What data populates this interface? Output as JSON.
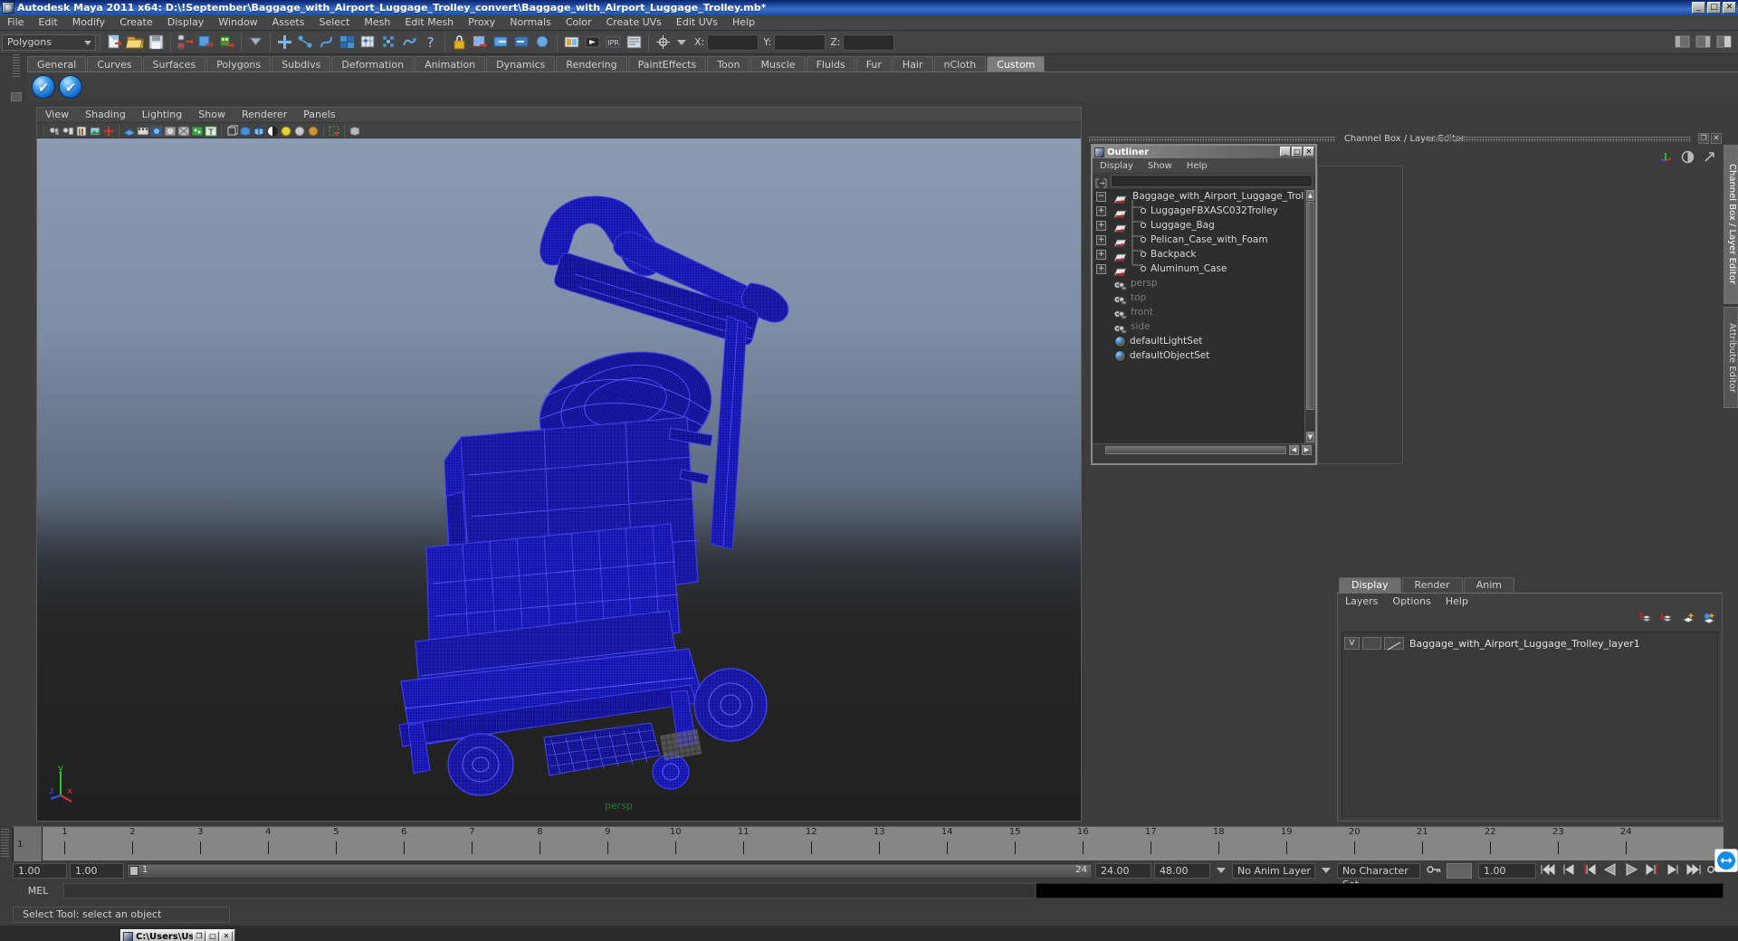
{
  "window": {
    "title": "Autodesk Maya 2011 x64: D:\\!September\\Baggage_with_Airport_Luggage_Trolley_convert\\Baggage_with_Airport_Luggage_Trolley.mb*",
    "minimize": "_",
    "maximize": "□",
    "close": "✕"
  },
  "menubar": {
    "items": [
      "File",
      "Edit",
      "Modify",
      "Create",
      "Display",
      "Window",
      "Assets",
      "Select",
      "Mesh",
      "Edit Mesh",
      "Proxy",
      "Normals",
      "Color",
      "Create UVs",
      "Edit UVs",
      "Help"
    ]
  },
  "statusline": {
    "selection_mode": "Polygons",
    "coord_labels": {
      "x": "X:",
      "y": "Y:",
      "z": "Z:"
    },
    "coord_values": {
      "x": "",
      "y": "",
      "z": ""
    }
  },
  "shelf": {
    "tabs": [
      "General",
      "Curves",
      "Surfaces",
      "Polygons",
      "Subdivs",
      "Deformation",
      "Animation",
      "Dynamics",
      "Rendering",
      "PaintEffects",
      "Toon",
      "Muscle",
      "Fluids",
      "Fur",
      "Hair",
      "nCloth",
      "Custom"
    ],
    "active_tab": "Custom",
    "buttons": [
      "shelf-check-icon-1",
      "shelf-check-icon-2"
    ]
  },
  "viewport": {
    "menus": [
      "View",
      "Shading",
      "Lighting",
      "Show",
      "Renderer",
      "Panels"
    ],
    "camera_label": "persp",
    "axis": {
      "x": "x",
      "y": "y",
      "z": "z"
    },
    "wireframe_color": "#1414c8",
    "background_top": "#8c9bb2",
    "background_bottom": "#202020"
  },
  "channelbox": {
    "title": "Channel Box / Layer Editor",
    "restore": "❐",
    "close": "✕"
  },
  "outliner": {
    "title": "Outliner",
    "menus": [
      "Display",
      "Show",
      "Help"
    ],
    "search_value": "",
    "minimize": "_",
    "maximize": "□",
    "close": "✕",
    "items": [
      {
        "label": "Baggage_with_Airport_Luggage_Trolley",
        "expander": "−",
        "icon": "mesh-icon",
        "depth": 0,
        "dim": false
      },
      {
        "label": "LuggageFBXASC032Trolley",
        "expander": "+",
        "icon": "mesh-icon",
        "depth": 1,
        "dim": false
      },
      {
        "label": "Luggage_Bag",
        "expander": "+",
        "icon": "mesh-icon",
        "depth": 1,
        "dim": false
      },
      {
        "label": "Pelican_Case_with_Foam",
        "expander": "+",
        "icon": "mesh-icon",
        "depth": 1,
        "dim": false
      },
      {
        "label": "Backpack",
        "expander": "+",
        "icon": "mesh-icon",
        "depth": 1,
        "dim": false
      },
      {
        "label": "Aluminum_Case",
        "expander": "+",
        "icon": "mesh-icon",
        "depth": 1,
        "dim": false
      },
      {
        "label": "persp",
        "expander": "",
        "icon": "camera-icon",
        "depth": 0,
        "dim": true
      },
      {
        "label": "top",
        "expander": "",
        "icon": "camera-icon",
        "depth": 0,
        "dim": true
      },
      {
        "label": "front",
        "expander": "",
        "icon": "camera-icon",
        "depth": 0,
        "dim": true
      },
      {
        "label": "side",
        "expander": "",
        "icon": "camera-icon",
        "depth": 0,
        "dim": true
      },
      {
        "label": "defaultLightSet",
        "expander": "",
        "icon": "set-icon",
        "depth": 0,
        "dim": false
      },
      {
        "label": "defaultObjectSet",
        "expander": "",
        "icon": "set-icon",
        "depth": 0,
        "dim": false
      }
    ]
  },
  "layer_editor": {
    "tabs": [
      "Display",
      "Render",
      "Anim"
    ],
    "active_tab": "Display",
    "menus": [
      "Layers",
      "Options",
      "Help"
    ],
    "toolbar_icons": [
      "move-layer-up-icon",
      "move-layer-down-icon",
      "new-layer-icon",
      "new-layer-from-selected-icon"
    ],
    "layers": [
      {
        "visibility": "V",
        "type": "",
        "name": "Baggage_with_Airport_Luggage_Trolley_layer1"
      }
    ]
  },
  "right_tabs": {
    "items": [
      "Channel Box / Layer Editor",
      "Attribute Editor"
    ],
    "active": "Channel Box / Layer Editor"
  },
  "timeline": {
    "ticks": [
      1,
      2,
      3,
      4,
      5,
      6,
      7,
      8,
      9,
      10,
      11,
      12,
      13,
      14,
      15,
      16,
      17,
      18,
      19,
      20,
      21,
      22,
      23,
      24
    ],
    "current_frame": "1",
    "current_time_field": "1.00"
  },
  "range_slider": {
    "start": "1.00",
    "end": "1.00",
    "range_start_label": "1",
    "range_end_label": "24",
    "playback_end": "24.00",
    "anim_end": "48.00",
    "anim_layer": "No Anim Layer",
    "character_set": "No Character Set",
    "playback_buttons": [
      "go-to-start-icon",
      "step-back-frame-icon",
      "step-back-key-icon",
      "play-backwards-icon",
      "play-forwards-icon",
      "step-forward-key-icon",
      "step-forward-frame-icon",
      "go-to-end-icon"
    ]
  },
  "command_line": {
    "label": "MEL",
    "input_value": "",
    "output_value": ""
  },
  "help_line": {
    "text": "Select Tool: select an object"
  },
  "taskbar": {
    "item_title": "C:\\Users\\Us...",
    "restore": "❐",
    "maximize": "□",
    "close": "✕"
  },
  "colors": {
    "title_blue": "#2a5ab5",
    "panel_gray": "#444444",
    "dark_panel": "#3a3a3a",
    "text_light": "#d2d2d2",
    "accent_green": "#1f7a34",
    "wire_blue": "#1414c8"
  }
}
